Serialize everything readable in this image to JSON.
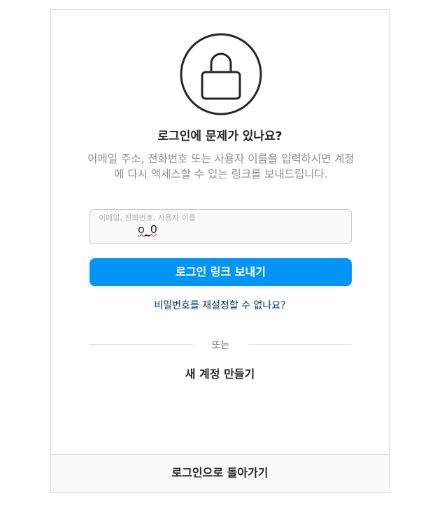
{
  "icons": {
    "lock": "lock-icon"
  },
  "title": "로그인에 문제가 있나요?",
  "description": "이메일 주소, 전화번호 또는 사용자 이름을 입력하시면 계정에 다시 액세스할 수 있는 링크를 보내드립니다.",
  "field": {
    "label": "이메일, 전화번호, 사용자 이름",
    "value": "o_0"
  },
  "send_button": "로그인 링크 보내기",
  "reset_link": "비밀번호를 재설정할 수 없나요?",
  "divider_text": "또는",
  "create_account": "새 계정 만들기",
  "back_to_login": "로그인으로 돌아가기",
  "colors": {
    "primary": "#0095f6",
    "link": "#00376b",
    "text": "#262626",
    "muted": "#8e8e8e",
    "border": "#dbdbdb"
  }
}
